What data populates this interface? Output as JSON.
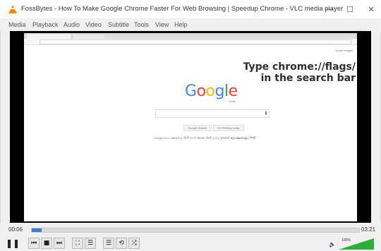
{
  "window": {
    "title": "FossBytes - How To Make Google Chrome Faster For Web Browsing | Speedup Chrome - VLC media player",
    "min": "—",
    "max": "☐",
    "close": "✕"
  },
  "menu": [
    "Media",
    "Playback",
    "Audio",
    "Video",
    "Subtitle",
    "Tools",
    "View",
    "Help"
  ],
  "video": {
    "overlay_line1": "Type chrome://flags/",
    "overlay_line2": "in the search bar",
    "top_right_links": "Gmail  Images",
    "google_letters": [
      {
        "ch": "G",
        "color": "#4285f4"
      },
      {
        "ch": "o",
        "color": "#ea4335"
      },
      {
        "ch": "o",
        "color": "#fbbc05"
      },
      {
        "ch": "g",
        "color": "#4285f4"
      },
      {
        "ch": "l",
        "color": "#34a853"
      },
      {
        "ch": "e",
        "color": "#ea4335"
      }
    ],
    "google_sub": "India",
    "btn_search": "Google Search",
    "btn_lucky": "I'm Feeling Lucky",
    "offered_in": "Google.co.in offered in: हिन्दी বাংলা తెలుగు मराठी தமிழ் ગુજરાતી ಕನ್ನಡ മലയാളം ਪੰਜਾਬੀ"
  },
  "player": {
    "time_elapsed": "00:06",
    "time_total": "03:21",
    "progress": 0.03,
    "volume_pct": "100%",
    "volume_level": 1.0,
    "controls": [
      {
        "name": "pause-button",
        "glyph": "❚❚"
      },
      {
        "name": "previous-button",
        "glyph": "⏮"
      },
      {
        "name": "stop-button",
        "glyph": "■"
      },
      {
        "name": "next-button",
        "glyph": "⏭"
      },
      {
        "name": "fullscreen-button",
        "glyph": "⛶"
      },
      {
        "name": "extended-settings-button",
        "glyph": "☰"
      },
      {
        "name": "playlist-button",
        "glyph": "☰"
      },
      {
        "name": "loop-button",
        "glyph": "⟲"
      },
      {
        "name": "shuffle-button",
        "glyph": "⤮"
      }
    ]
  },
  "colors": {
    "accent": "#3d7ad6",
    "volume": "#2eae3a",
    "vlc_cone": "#ff8800"
  }
}
